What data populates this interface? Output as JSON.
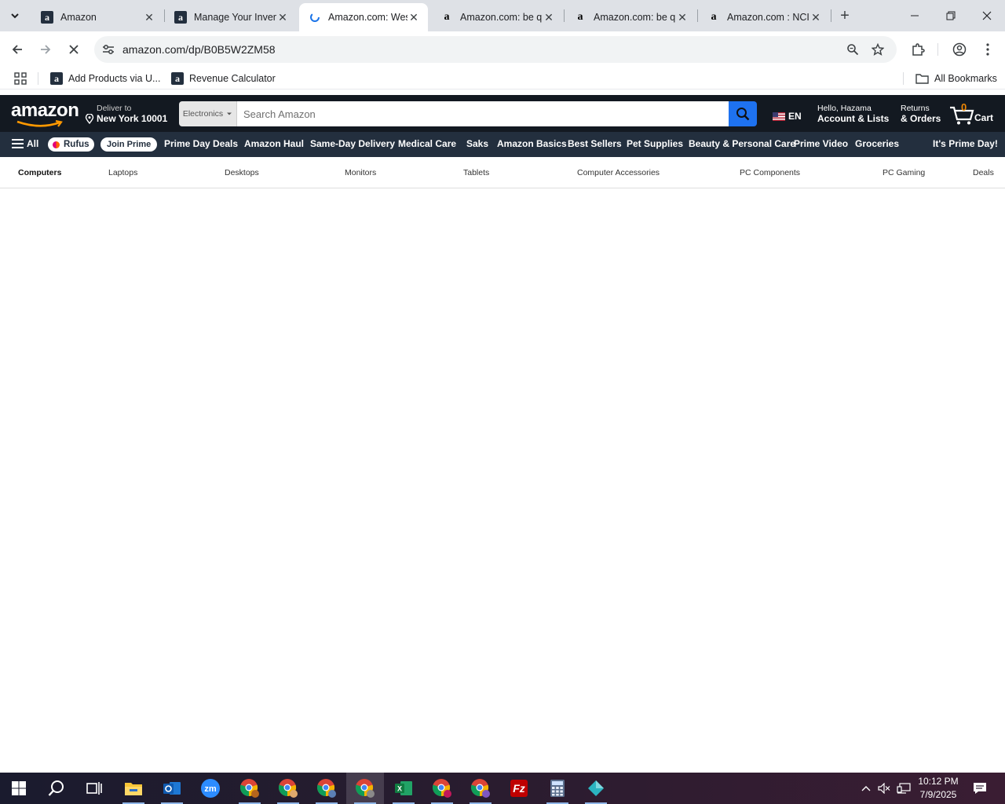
{
  "browser": {
    "tabs": [
      {
        "title": "Amazon",
        "favicon": "a"
      },
      {
        "title": "Manage Your Inventory",
        "favicon": "a"
      },
      {
        "title": "Amazon.com: Western",
        "favicon": "loading"
      },
      {
        "title": "Amazon.com: be quiet",
        "favicon": "a"
      },
      {
        "title": "Amazon.com: be quiet",
        "favicon": "a"
      },
      {
        "title": "Amazon.com : NCI",
        "favicon": "a"
      }
    ],
    "active_tab": 2,
    "url": "amazon.com/dp/B0B5W2ZM58",
    "bookmarks": [
      {
        "label": "Add Products via U..."
      },
      {
        "label": "Revenue Calculator"
      }
    ],
    "all_bookmarks": "All Bookmarks"
  },
  "amazon": {
    "logo": "amazon",
    "deliver_to": "Deliver to",
    "location": "New York 10001",
    "search_category": "Electronics",
    "search_placeholder": "Search Amazon",
    "language": "EN",
    "greeting": "Hello, Hazama",
    "account": "Account & Lists",
    "returns": "Returns",
    "orders": "& Orders",
    "cart_count": "0",
    "cart_label": "Cart",
    "nav": {
      "all": "All",
      "rufus": "Rufus",
      "join_prime": "Join Prime",
      "items": [
        "Prime Day Deals",
        "Amazon Haul",
        "Same-Day Delivery",
        "Medical Care",
        "Saks",
        "Amazon Basics",
        "Best Sellers",
        "Pet Supplies",
        "Beauty & Personal Care",
        "Prime Video",
        "Groceries"
      ],
      "promo": "It's Prime Day!"
    },
    "subnav": [
      "Computers",
      "Laptops",
      "Desktops",
      "Monitors",
      "Tablets",
      "Computer Accessories",
      "PC Components",
      "PC Gaming",
      "Deals"
    ]
  },
  "taskbar": {
    "time": "10:12 PM",
    "date": "7/9/2025"
  },
  "colors": {
    "amazon_dark": "#131921",
    "amazon_nav": "#232f3e",
    "search_button": "#1e72f0",
    "cart_count": "#f08804"
  }
}
